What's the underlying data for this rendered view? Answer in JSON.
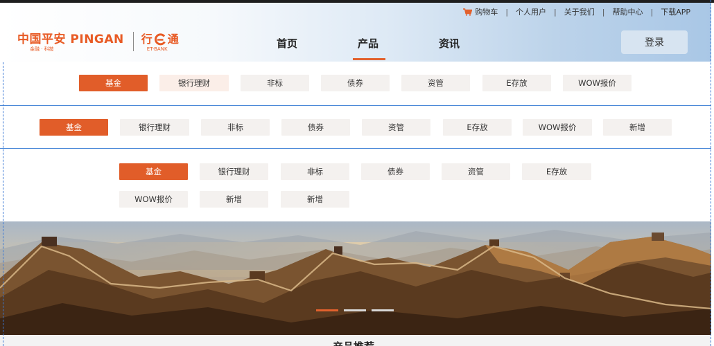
{
  "topbar": {
    "links": [
      "购物车",
      "个人用户",
      "关于我们",
      "帮助中心",
      "下载APP"
    ],
    "separator": "|",
    "cart_icon": "cart-icon"
  },
  "logo": {
    "brand_main": "中国平安 PINGAN",
    "brand_sub": "金融 · 科技",
    "product_main_left": "行",
    "product_main_right": "通",
    "product_sub": "ET-BANK"
  },
  "nav": {
    "items": [
      "首页",
      "产品",
      "资讯"
    ],
    "active": "产品"
  },
  "login_label": "登录",
  "tab_rows": {
    "row1": [
      "基金",
      "银行理财",
      "非标",
      "债券",
      "资管",
      "E存放",
      "WOW报价"
    ],
    "row2": [
      "基金",
      "银行理财",
      "非标",
      "债券",
      "资管",
      "E存放",
      "WOW报价",
      "新增"
    ],
    "row3": [
      "基金",
      "银行理财",
      "非标",
      "债券",
      "资管",
      "E存放",
      "WOW报价",
      "新增",
      "新增"
    ]
  },
  "colors": {
    "accent": "#e15d29",
    "tab_bg": "#f4f1ef",
    "guide": "#4a88d8"
  },
  "banner": {
    "slide_count": 3,
    "active_slide": 1
  },
  "section_title": "产品推荐"
}
